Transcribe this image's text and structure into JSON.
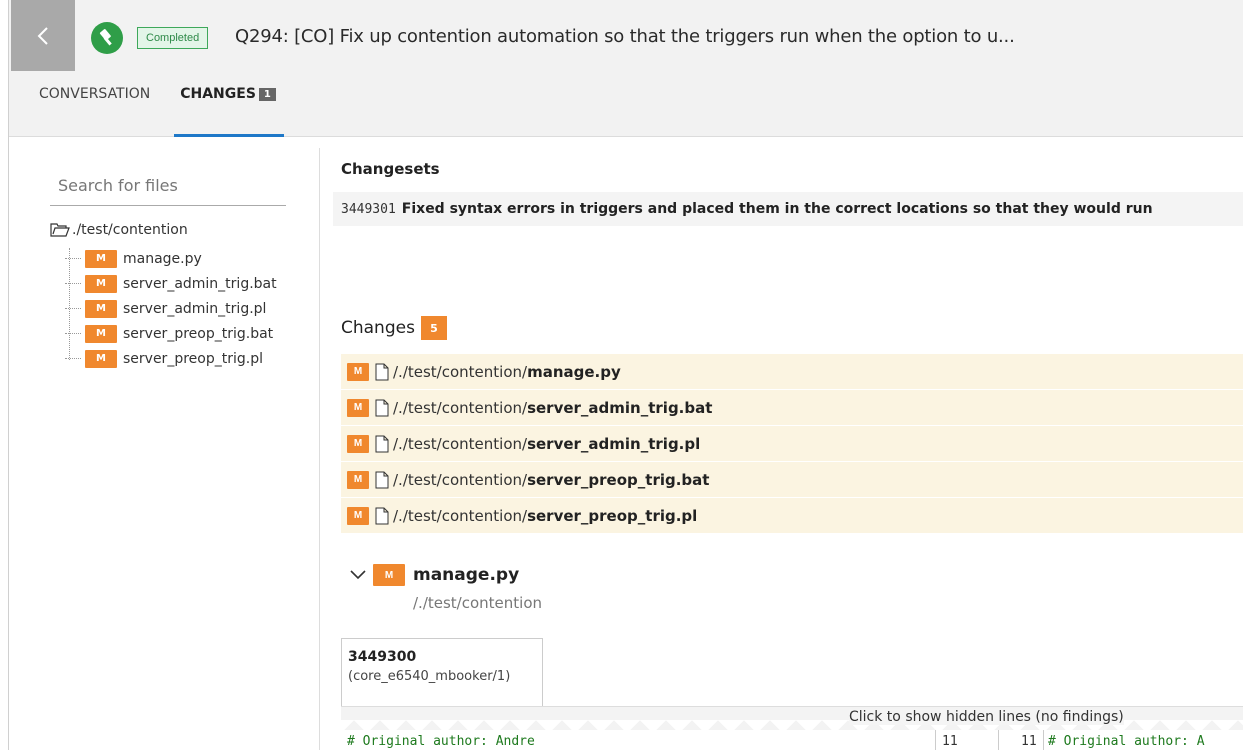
{
  "header": {
    "status": "Completed",
    "title": "Q294: [CO] Fix up contention automation so that the triggers run when the option to u...",
    "tabs": [
      {
        "label": "CONVERSATION"
      },
      {
        "label": "CHANGES",
        "count": "1"
      }
    ]
  },
  "sidebar": {
    "search_placeholder": "Search for files",
    "root": "./test/contention",
    "badge": "M",
    "files": [
      "manage.py",
      "server_admin_trig.bat",
      "server_admin_trig.pl",
      "server_preop_trig.bat",
      "server_preop_trig.pl"
    ]
  },
  "changesets": {
    "heading": "Changesets",
    "id": "3449301",
    "description": "Fixed syntax errors in triggers and placed them in the correct locations so that they would run"
  },
  "changes": {
    "heading": "Changes",
    "count": "5",
    "badge": "M",
    "dir": "/./test/contention/",
    "files": [
      "manage.py",
      "server_admin_trig.bat",
      "server_admin_trig.pl",
      "server_preop_trig.bat",
      "server_preop_trig.pl"
    ]
  },
  "file_view": {
    "badge": "M",
    "name": "manage.py",
    "dir": "/./test/contention",
    "revision": "3449300",
    "revision_sub": "(core_e6540_mbooker/1)",
    "hidden_lines": "Click to show hidden lines (no findings)",
    "code_left": "# Original author: Andre",
    "line_left": "11",
    "line_right": "11",
    "code_right": "# Original author: A"
  },
  "colors": {
    "accent": "#1e78c8",
    "badge": "#f0882e",
    "success": "#2f9e48"
  }
}
